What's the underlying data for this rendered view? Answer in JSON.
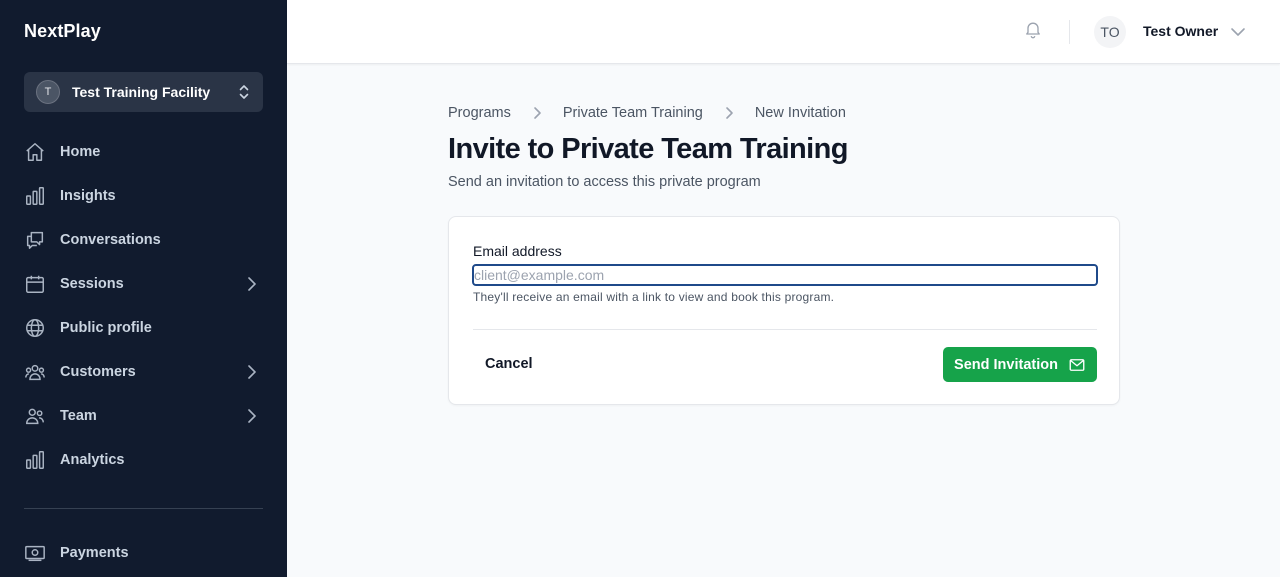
{
  "sidebar": {
    "brand": "NextPlay",
    "facility": {
      "initial": "T",
      "name": "Test Training Facility"
    },
    "items": [
      {
        "label": "Home",
        "icon": "home-icon"
      },
      {
        "label": "Insights",
        "icon": "bar-chart-icon"
      },
      {
        "label": "Conversations",
        "icon": "chat-icon"
      },
      {
        "label": "Sessions",
        "icon": "calendar-icon",
        "expandable": true
      },
      {
        "label": "Public profile",
        "icon": "globe-icon"
      },
      {
        "label": "Customers",
        "icon": "users-icon",
        "expandable": true
      },
      {
        "label": "Team",
        "icon": "team-icon",
        "expandable": true
      },
      {
        "label": "Analytics",
        "icon": "bar-chart-icon"
      }
    ],
    "bottom_items": [
      {
        "label": "Payments",
        "icon": "cash-icon"
      }
    ]
  },
  "header": {
    "avatar_initials": "TO",
    "user_name": "Test Owner"
  },
  "breadcrumb": [
    "Programs",
    "Private Team Training",
    "New Invitation"
  ],
  "page": {
    "title": "Invite to Private Team Training",
    "subtitle": "Send an invitation to access this private program"
  },
  "form": {
    "email_label": "Email address",
    "email_value": "",
    "email_placeholder": "client@example.com",
    "hint": "They'll receive an email with a link to view and book this program.",
    "cancel_label": "Cancel",
    "submit_label": "Send Invitation"
  },
  "colors": {
    "sidebar_bg": "#111b2e",
    "primary": "#16a34a",
    "focus_ring": "#1f4a8a"
  }
}
